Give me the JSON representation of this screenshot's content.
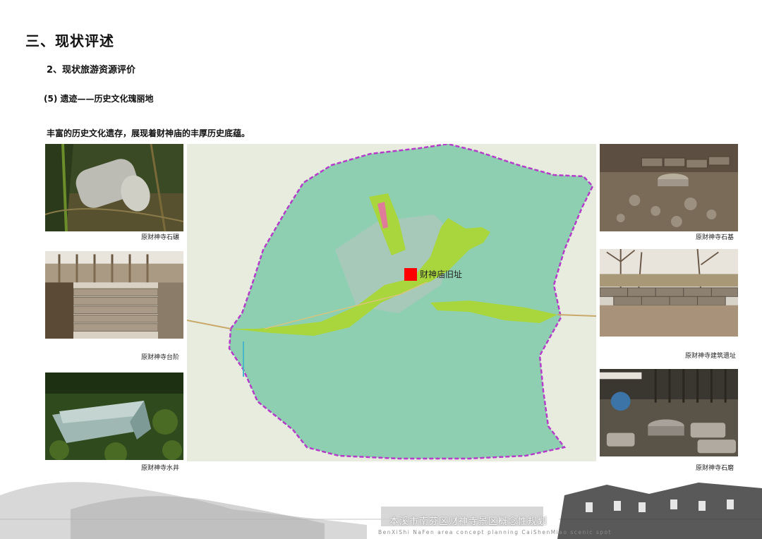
{
  "section_title": "三、现状评述",
  "subsection_title": "2、现状旅游资源评价",
  "item_title": "(5) 遗迹——历史文化瑰丽地",
  "intro_text": "丰富的历史文化遗存，展现着财神庙的丰厚历史底蕴。",
  "photos_left": [
    {
      "caption": "原财神寺石碾"
    },
    {
      "caption": "原财神寺台阶"
    },
    {
      "caption": "原财神寺水井"
    }
  ],
  "photos_right": [
    {
      "caption": "原财神寺石基"
    },
    {
      "caption": "原财神寺建筑遗址"
    },
    {
      "caption": "原财神寺石磨"
    }
  ],
  "map": {
    "site_label": "财神庙旧址",
    "colors": {
      "background": "#e8ecdf",
      "scenic_area": "#8ecfb2",
      "boundary": "#b43cc8",
      "valley": "#a8d63c",
      "site_marker": "#ff0000"
    }
  },
  "footer": {
    "title_cn": "本溪市南芬区财神寺景区概念性规划",
    "title_en": "BenXiShi NaFen area concept planning CaiShenMiao scenic spot"
  }
}
